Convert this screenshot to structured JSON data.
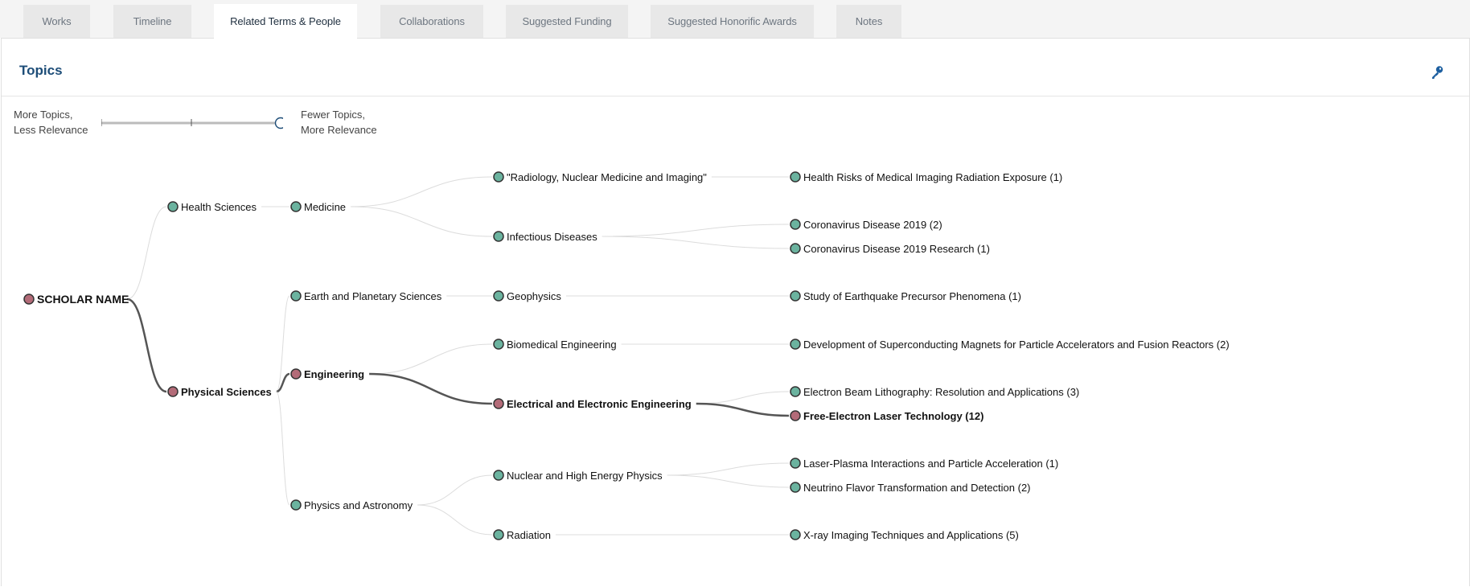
{
  "tabs": [
    {
      "label": "Works",
      "active": false
    },
    {
      "label": "Timeline",
      "active": false
    },
    {
      "label": "Related Terms & People",
      "active": true
    },
    {
      "label": "Collaborations",
      "active": false
    },
    {
      "label": "Suggested Funding",
      "active": false
    },
    {
      "label": "Suggested Honorific Awards",
      "active": false
    },
    {
      "label": "Notes",
      "active": false
    }
  ],
  "topics": {
    "title": "Topics",
    "key_icon": "key-icon",
    "slider": {
      "left_label_line1": "More Topics,",
      "left_label_line2": "Less Relevance",
      "right_label_line1": "Fewer Topics,",
      "right_label_line2": "More Relevance",
      "position": "max"
    }
  },
  "colors": {
    "node_default": "#6bb39f",
    "node_selected": "#b36b78",
    "node_stroke": "#333333",
    "link_default": "#dcdcdc",
    "link_selected": "#555555",
    "title_color": "#1d4d78"
  },
  "tree": {
    "root": {
      "label": "SCHOLAR NAME",
      "selected": true
    },
    "nodes": [
      {
        "id": "hs",
        "label": "Health Sciences",
        "parent": "root",
        "selected": false
      },
      {
        "id": "ps",
        "label": "Physical Sciences",
        "parent": "root",
        "selected": true
      },
      {
        "id": "med",
        "label": "Medicine",
        "parent": "hs",
        "selected": false
      },
      {
        "id": "eps",
        "label": "Earth and Planetary Sciences",
        "parent": "ps",
        "selected": false
      },
      {
        "id": "eng",
        "label": "Engineering",
        "parent": "ps",
        "selected": true
      },
      {
        "id": "pa",
        "label": "Physics and Astronomy",
        "parent": "ps",
        "selected": false
      },
      {
        "id": "rad_nm",
        "label": "\"Radiology, Nuclear Medicine and Imaging\"",
        "parent": "med",
        "selected": false
      },
      {
        "id": "inf",
        "label": "Infectious Diseases",
        "parent": "med",
        "selected": false
      },
      {
        "id": "geo",
        "label": "Geophysics",
        "parent": "eps",
        "selected": false
      },
      {
        "id": "bme",
        "label": "Biomedical Engineering",
        "parent": "eng",
        "selected": false
      },
      {
        "id": "eee",
        "label": "Electrical and Electronic Engineering",
        "parent": "eng",
        "selected": true
      },
      {
        "id": "nhep",
        "label": "Nuclear and High Energy Physics",
        "parent": "pa",
        "selected": false
      },
      {
        "id": "radn",
        "label": "Radiation",
        "parent": "pa",
        "selected": false
      },
      {
        "id": "t1",
        "label": "Health Risks of Medical Imaging Radiation Exposure (1)",
        "parent": "rad_nm",
        "selected": false
      },
      {
        "id": "t2",
        "label": "Coronavirus Disease 2019 (2)",
        "parent": "inf",
        "selected": false
      },
      {
        "id": "t3",
        "label": "Coronavirus Disease 2019 Research (1)",
        "parent": "inf",
        "selected": false
      },
      {
        "id": "t4",
        "label": "Study of Earthquake Precursor Phenomena (1)",
        "parent": "geo",
        "selected": false
      },
      {
        "id": "t5",
        "label": "Development of Superconducting Magnets for Particle Accelerators and Fusion Reactors (2)",
        "parent": "bme",
        "selected": false
      },
      {
        "id": "t6",
        "label": "Electron Beam Lithography: Resolution and Applications (3)",
        "parent": "eee",
        "selected": false
      },
      {
        "id": "t7",
        "label": "Free-Electron Laser Technology (12)",
        "parent": "eee",
        "selected": true
      },
      {
        "id": "t8",
        "label": "Laser-Plasma Interactions and Particle Acceleration (1)",
        "parent": "nhep",
        "selected": false
      },
      {
        "id": "t9",
        "label": "Neutrino Flavor Transformation and Detection (2)",
        "parent": "nhep",
        "selected": false
      },
      {
        "id": "t10",
        "label": "X-ray Imaging Techniques and Applications (5)",
        "parent": "radn",
        "selected": false
      }
    ]
  }
}
